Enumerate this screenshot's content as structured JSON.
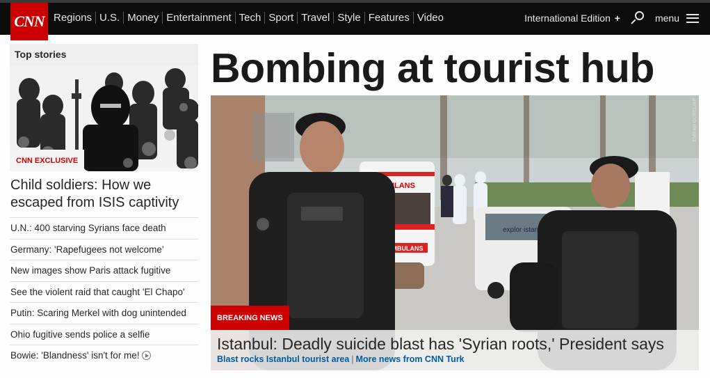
{
  "nav": {
    "logo": "CNN",
    "links": [
      "Regions",
      "U.S.",
      "Money",
      "Entertainment",
      "Tech",
      "Sport",
      "Travel",
      "Style",
      "Features",
      "Video"
    ],
    "edition": "International Edition",
    "edition_plus": "+",
    "menu": "menu"
  },
  "top_stories": {
    "heading": "Top stories",
    "badge": "CNN EXCLUSIVE",
    "lead_headline": "Child soldiers: How we escaped from ISIS captivity",
    "items": [
      "U.N.: 400 starving Syrians face death",
      "Germany: 'Rapefugees not welcome'",
      "New images show Paris attack fugitive",
      "See the violent raid that caught 'El Chapo'",
      "Putin: Scaring Merkel with dog unintended",
      "Ohio fugitive sends police a selfie",
      "Bowie: 'Blandness' isn't for me!"
    ]
  },
  "main": {
    "headline": "Bombing at tourist hub",
    "photo_credit": "EMRAH GUREL/AP",
    "photo_text": {
      "ambulance_front": "AMBULANS",
      "ambulance_side": "AMBULANS",
      "van_text": "explor istanbul"
    },
    "breaking_label": "BREAKING NEWS",
    "caption": "Istanbul: Deadly suicide blast has 'Syrian roots,' President says",
    "links": [
      "Blast rocks Istanbul tourist area",
      "More news from CNN Turk"
    ]
  },
  "colors": {
    "brand_red": "#cc0000",
    "nav_bg": "#0c0c0c",
    "link_blue": "#005c9f"
  }
}
